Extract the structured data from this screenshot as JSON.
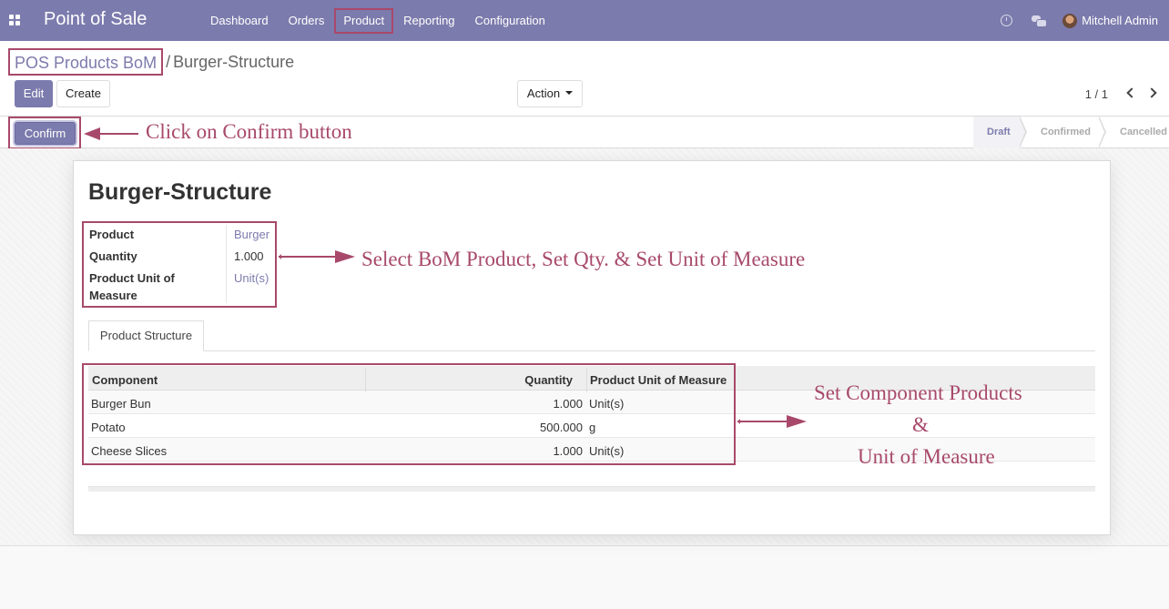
{
  "app": {
    "title": "Point of Sale"
  },
  "menu": {
    "items": [
      "Dashboard",
      "Orders",
      "Product",
      "Reporting",
      "Configuration"
    ]
  },
  "user": {
    "name": "Mitchell Admin"
  },
  "breadcrumb": {
    "parent": "POS Products BoM",
    "separator": "/",
    "current": "Burger-Structure"
  },
  "toolbar": {
    "edit_label": "Edit",
    "create_label": "Create",
    "action_label": "Action"
  },
  "pager": {
    "value": "1 / 1"
  },
  "status": {
    "confirm_label": "Confirm",
    "states": [
      "Draft",
      "Confirmed",
      "Cancelled"
    ],
    "active_state": "Draft"
  },
  "form": {
    "title": "Burger-Structure",
    "fields": [
      {
        "label": "Product",
        "value": "Burger"
      },
      {
        "label": "Quantity",
        "value": "1.000"
      },
      {
        "label": "Product Unit of",
        "label2": "Measure",
        "value": "Unit(s)"
      }
    ],
    "tab": "Product Structure",
    "table": {
      "headers": [
        "Component",
        "Quantity",
        "Product Unit of Measure"
      ],
      "rows": [
        [
          "Burger Bun",
          "1.000",
          "Unit(s)"
        ],
        [
          "Potato",
          "500.000",
          "g"
        ],
        [
          "Cheese Slices",
          "1.000",
          "Unit(s)"
        ]
      ]
    }
  },
  "annotations": {
    "confirm": "Click on Confirm button",
    "fields": "Select BoM Product, Set Qty. & Set Unit of Measure",
    "components_line1": "Set Component Products",
    "components_line2": "&",
    "components_line3": "Unit of Measure"
  },
  "colors": {
    "brand": "#7c7bad",
    "annotation": "#a8496b"
  }
}
